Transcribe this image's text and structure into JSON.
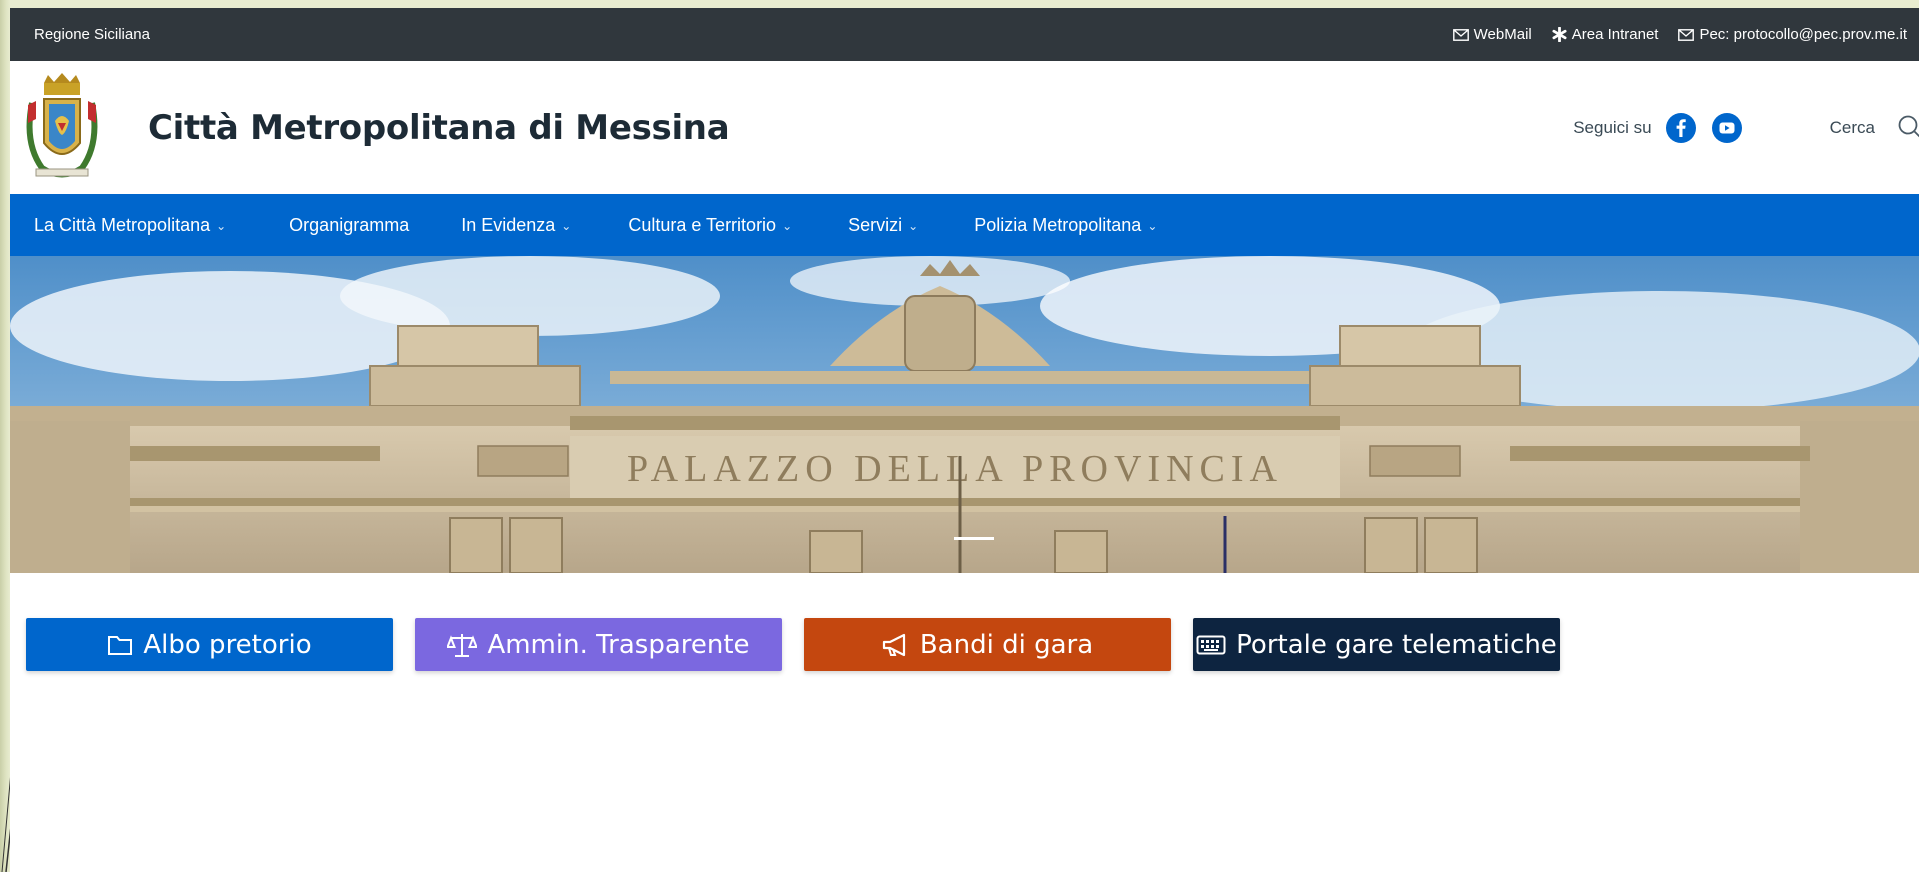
{
  "topbar": {
    "region": "Regione Siciliana",
    "webmail": "WebMail",
    "intranet": "Area Intranet",
    "pec": "Pec: protocollo@pec.prov.me.it"
  },
  "header": {
    "title": "Città Metropolitana di Messina",
    "follow_label": "Seguici su",
    "search_label": "Cerca"
  },
  "nav": {
    "items": [
      {
        "label": "La Città Metropolitana",
        "dropdown": "⌄"
      },
      {
        "label": "Organigramma",
        "dropdown": ""
      },
      {
        "label": "In Evidenza",
        "dropdown": "⌄"
      },
      {
        "label": "Cultura e Territorio",
        "dropdown": "⌄"
      },
      {
        "label": "Servizi",
        "dropdown": "⌄"
      },
      {
        "label": "Polizia Metropolitana",
        "dropdown": "⌄"
      }
    ]
  },
  "hero": {
    "inscription": "PALAZZO DELLA PROVINCIA"
  },
  "quick_links": {
    "albo": "Albo pretorio",
    "trasparente": "Ammin. Trasparente",
    "bandi": "Bandi di gara",
    "portale": "Portale gare telematiche"
  },
  "colors": {
    "topbar": "#30373d",
    "brand_blue": "#0066cc",
    "albo": "#0066cc",
    "trasparente": "#7b68e0",
    "bandi": "#c4470f",
    "portale": "#0d2440"
  }
}
